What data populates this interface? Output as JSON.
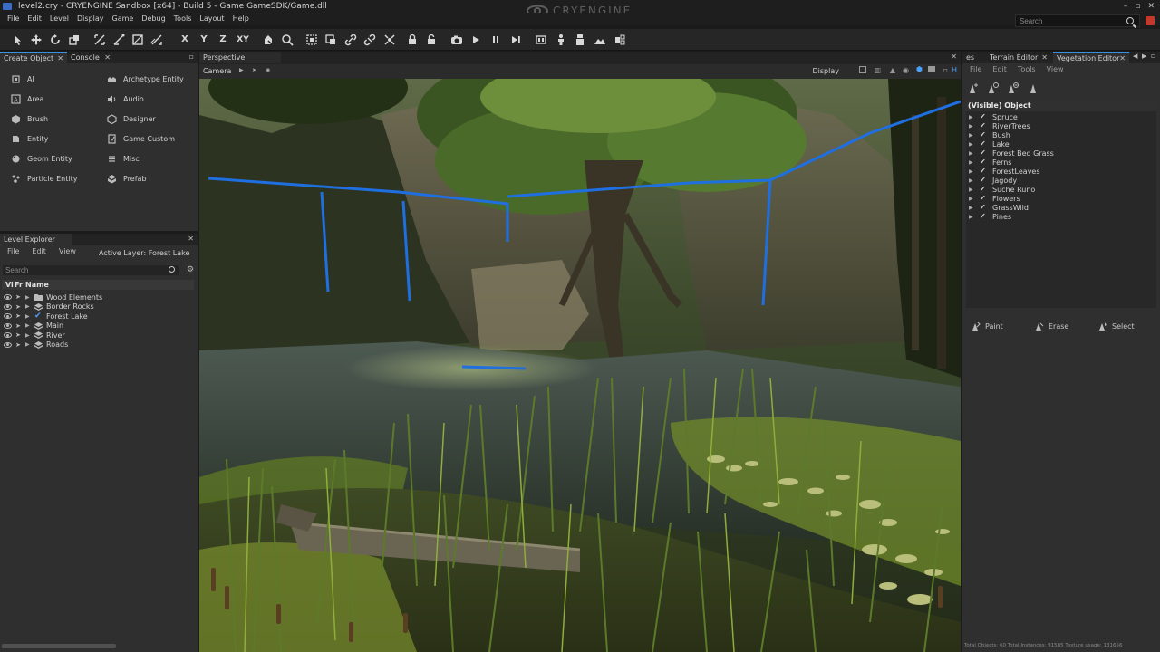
{
  "window": {
    "title": "level2.cry - CRYENGINE Sandbox  [x64] - Build 5 - Game GameSDK/Game.dll",
    "brand": "CRYENGINE"
  },
  "menubar": [
    "File",
    "Edit",
    "Level",
    "Display",
    "Game",
    "Debug",
    "Tools",
    "Layout",
    "Help"
  ],
  "search": {
    "placeholder": "Search"
  },
  "toolbar": {
    "axis_x": "X",
    "axis_y": "Y",
    "axis_z": "Z",
    "axis_xy": "XY"
  },
  "create_panel": {
    "tabs": [
      {
        "label": "Create Object"
      },
      {
        "label": "Console"
      }
    ],
    "items": [
      {
        "label": "AI",
        "icon": "ai-icon"
      },
      {
        "label": "Archetype Entity",
        "icon": "archetype-icon"
      },
      {
        "label": "Area",
        "icon": "area-icon"
      },
      {
        "label": "Audio",
        "icon": "audio-icon"
      },
      {
        "label": "Brush",
        "icon": "brush-icon"
      },
      {
        "label": "Designer",
        "icon": "designer-icon"
      },
      {
        "label": "Entity",
        "icon": "entity-icon"
      },
      {
        "label": "Game Custom",
        "icon": "game-custom-icon"
      },
      {
        "label": "Geom Entity",
        "icon": "geom-entity-icon"
      },
      {
        "label": "Misc",
        "icon": "misc-icon"
      },
      {
        "label": "Particle Entity",
        "icon": "particle-icon"
      },
      {
        "label": "Prefab",
        "icon": "prefab-icon"
      }
    ]
  },
  "level_explorer": {
    "title": "Level Explorer",
    "menus": [
      "File",
      "Edit",
      "View"
    ],
    "active_layer": "Active Layer: Forest Lake",
    "search_placeholder": "Search",
    "columns": {
      "vis": "Vi",
      "freeze": "Fr",
      "name": "Name"
    },
    "layers": [
      {
        "name": "Wood Elements",
        "type": "folder"
      },
      {
        "name": "Border Rocks",
        "type": "layer"
      },
      {
        "name": "Forest Lake",
        "type": "active"
      },
      {
        "name": "Main",
        "type": "layer"
      },
      {
        "name": "River",
        "type": "layer"
      },
      {
        "name": "Roads",
        "type": "layer"
      }
    ]
  },
  "viewport": {
    "tab": "Perspective",
    "camera_label": "Camera",
    "display_label": "Display",
    "h_label": "H"
  },
  "right_panel": {
    "tabs": [
      {
        "label": "es"
      },
      {
        "label": "Terrain Editor"
      },
      {
        "label": "Vegetation Editor"
      }
    ],
    "menus": [
      "File",
      "Edit",
      "Tools",
      "View"
    ],
    "list_header": "(Visible) Object",
    "objects": [
      "Spruce",
      "RiverTrees",
      "Bush",
      "Lake",
      "Forest Bed Grass",
      "Ferns",
      "ForestLeaves",
      "Jagody",
      "Suche Runo",
      "Flowers",
      "GrassWild",
      "Pines"
    ],
    "actions": [
      {
        "label": "Paint"
      },
      {
        "label": "Erase"
      },
      {
        "label": "Select"
      }
    ]
  },
  "status": {
    "text": "Total Objects: 60  Total Instances: 91585  Texture usage: 131656"
  },
  "colors": {
    "accent": "#3a8fe0",
    "selection_line": "#1f6fe0",
    "close_button": "#c0392b"
  }
}
